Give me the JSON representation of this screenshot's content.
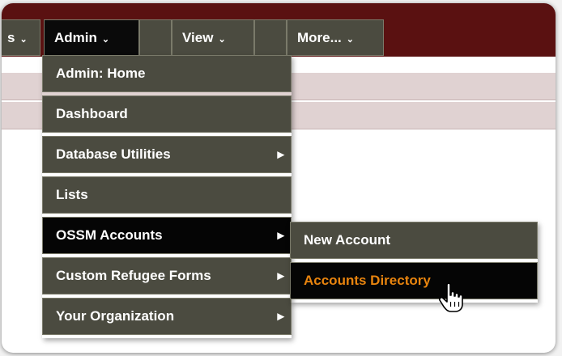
{
  "nav": {
    "tabs": [
      {
        "label": "s",
        "chevron": "⌄"
      },
      {
        "label": "Admin",
        "chevron": "⌄"
      },
      {
        "label": "View",
        "chevron": "⌄"
      },
      {
        "label": "More...",
        "chevron": "⌄"
      }
    ]
  },
  "admin_menu": {
    "items": [
      {
        "label": "Admin: Home",
        "has_submenu": false
      },
      {
        "label": "Dashboard",
        "has_submenu": false
      },
      {
        "label": "Database Utilities",
        "has_submenu": true
      },
      {
        "label": "Lists",
        "has_submenu": false
      },
      {
        "label": "OSSM Accounts",
        "has_submenu": true,
        "active": true
      },
      {
        "label": "Custom Refugee Forms",
        "has_submenu": true
      },
      {
        "label": "Your Organization",
        "has_submenu": true
      }
    ],
    "submenu_arrow": "▶"
  },
  "accounts_submenu": {
    "items": [
      {
        "label": "New Account"
      },
      {
        "label": "Accounts Directory",
        "active": true
      }
    ]
  },
  "colors": {
    "topbar": "#5a1111",
    "menu_bg": "#4b4b40",
    "active_bg": "#050505",
    "active_text": "#e8840e",
    "strip_bg": "#e0d2d2"
  },
  "icons": {
    "menu_arrow": "submenu-arrow-icon",
    "pointer": "hand-pointer-icon"
  }
}
